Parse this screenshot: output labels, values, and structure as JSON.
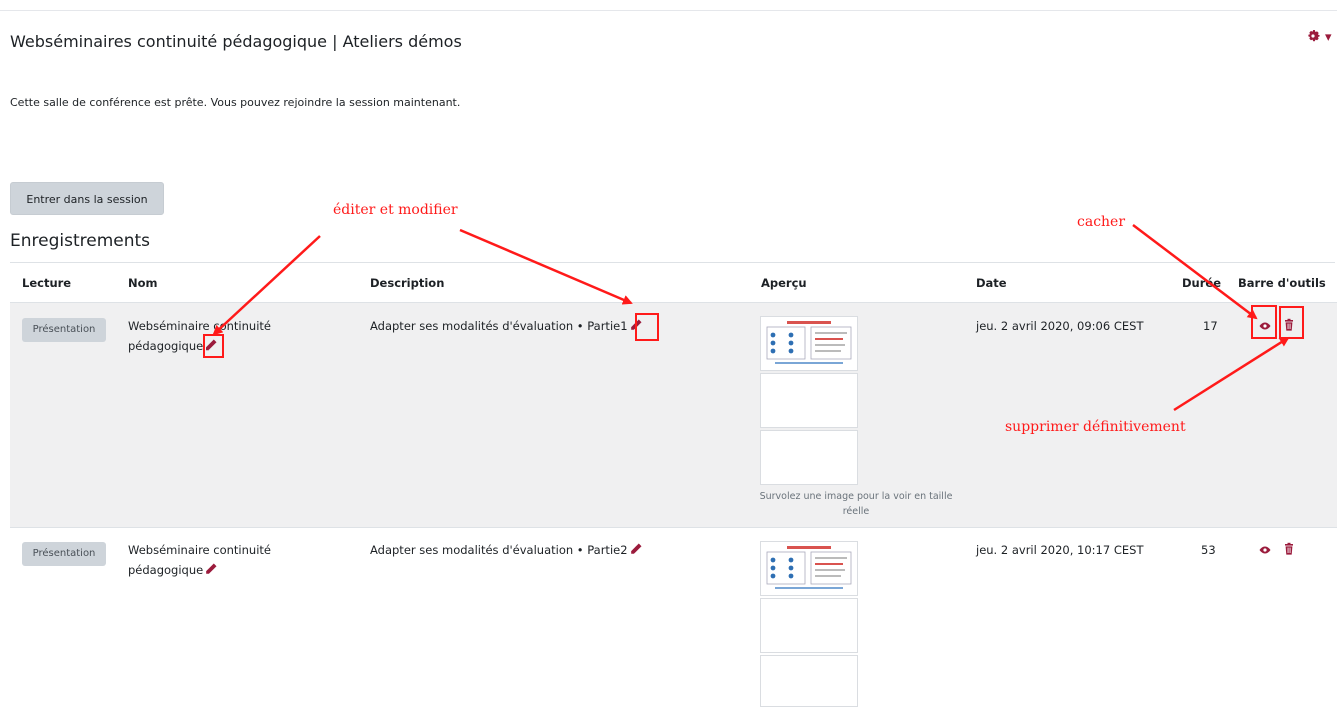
{
  "header": {
    "title": "Webséminaires continuité pédagogique | Ateliers démos",
    "gear_icon": "gear-icon",
    "caret": "▾"
  },
  "status_message": "Cette salle de conférence est prête. Vous pouvez rejoindre la session maintenant.",
  "enter_button": "Entrer dans la session",
  "recordings": {
    "title": "Enregistrements",
    "columns": [
      "Lecture",
      "Nom",
      "Description",
      "Aperçu",
      "Date",
      "Durée",
      "Barre d'outils"
    ],
    "rows": [
      {
        "lecture": "Présentation",
        "name_line1": "Webséminaire continuité",
        "name_line2": "pédagogique",
        "description": "Adapter ses modalités d'évaluation • Partie1",
        "date": "jeu. 2 avril 2020, 09:06 CEST",
        "duration": "17",
        "preview_hint_line1": "Survolez une image pour la voir en taille",
        "preview_hint_line2": "réelle"
      },
      {
        "lecture": "Présentation",
        "name_line1": "Webséminaire continuité",
        "name_line2": "pédagogique",
        "description": "Adapter ses modalités d'évaluation • Partie2",
        "date": "jeu. 2 avril 2020, 10:17 CEST",
        "duration": "53"
      }
    ]
  },
  "annotations": {
    "edit": "éditer et modifier",
    "hide": "cacher",
    "delete": "supprimer définitivement"
  },
  "colors": {
    "accent": "#9b1b3c",
    "annotation": "#ff1a1a",
    "row_highlight": "#f0f0f1"
  },
  "icons": {
    "edit": "pencil-icon",
    "hide": "eye-icon",
    "delete": "trash-icon"
  }
}
